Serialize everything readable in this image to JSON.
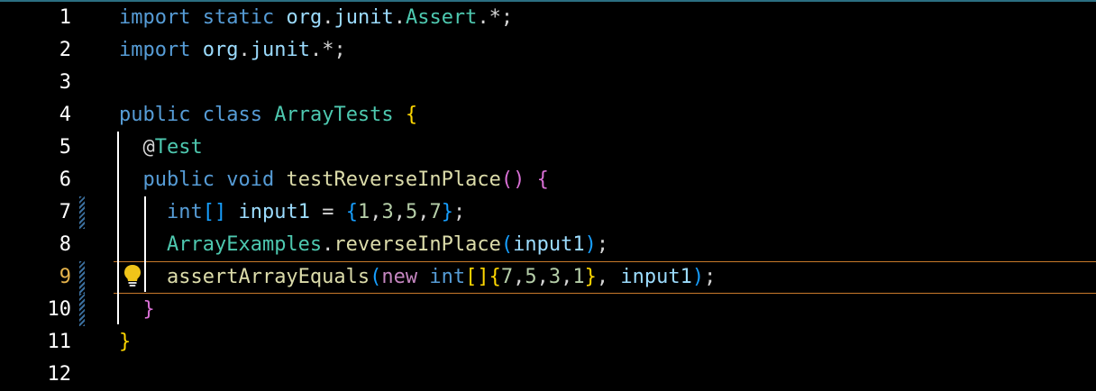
{
  "editor": {
    "active_line": 9,
    "lines": [
      {
        "n": "1",
        "tokens": [
          [
            "kw",
            "import"
          ],
          [
            "pl",
            " "
          ],
          [
            "kw",
            "static"
          ],
          [
            "pl",
            " "
          ],
          [
            "id",
            "org"
          ],
          [
            "pl",
            "."
          ],
          [
            "id",
            "junit"
          ],
          [
            "pl",
            "."
          ],
          [
            "ty",
            "Assert"
          ],
          [
            "pl",
            ".*;"
          ]
        ]
      },
      {
        "n": "2",
        "tokens": [
          [
            "kw",
            "import"
          ],
          [
            "pl",
            " "
          ],
          [
            "id",
            "org"
          ],
          [
            "pl",
            "."
          ],
          [
            "id",
            "junit"
          ],
          [
            "pl",
            ".*;"
          ]
        ]
      },
      {
        "n": "3",
        "tokens": []
      },
      {
        "n": "4",
        "tokens": [
          [
            "kw",
            "public"
          ],
          [
            "pl",
            " "
          ],
          [
            "kw",
            "class"
          ],
          [
            "pl",
            " "
          ],
          [
            "ty",
            "ArrayTests"
          ],
          [
            "pl",
            " "
          ],
          [
            "br1",
            "{"
          ]
        ]
      },
      {
        "n": "5",
        "tokens": [
          [
            "pl",
            "  "
          ],
          [
            "pl",
            "@"
          ],
          [
            "ty",
            "Test"
          ]
        ]
      },
      {
        "n": "6",
        "tokens": [
          [
            "pl",
            "  "
          ],
          [
            "kw",
            "public"
          ],
          [
            "pl",
            " "
          ],
          [
            "kw",
            "void"
          ],
          [
            "pl",
            " "
          ],
          [
            "fn",
            "testReverseInPlace"
          ],
          [
            "br2",
            "()"
          ],
          [
            "pl",
            " "
          ],
          [
            "br2",
            "{"
          ]
        ]
      },
      {
        "n": "7",
        "tokens": [
          [
            "pl",
            "    "
          ],
          [
            "kw",
            "int"
          ],
          [
            "br3",
            "[]"
          ],
          [
            "pl",
            " "
          ],
          [
            "id",
            "input1"
          ],
          [
            "pl",
            " = "
          ],
          [
            "br3",
            "{"
          ],
          [
            "num",
            "1"
          ],
          [
            "pl",
            ","
          ],
          [
            "num",
            "3"
          ],
          [
            "pl",
            ","
          ],
          [
            "num",
            "5"
          ],
          [
            "pl",
            ","
          ],
          [
            "num",
            "7"
          ],
          [
            "br3",
            "}"
          ],
          [
            "pl",
            ";"
          ]
        ]
      },
      {
        "n": "8",
        "tokens": [
          [
            "pl",
            "    "
          ],
          [
            "ty",
            "ArrayExamples"
          ],
          [
            "pl",
            "."
          ],
          [
            "fn",
            "reverseInPlace"
          ],
          [
            "br3",
            "("
          ],
          [
            "id",
            "input1"
          ],
          [
            "br3",
            ")"
          ],
          [
            "pl",
            ";"
          ]
        ]
      },
      {
        "n": "9",
        "tokens": [
          [
            "pl",
            "    "
          ],
          [
            "fn",
            "assertArrayEquals"
          ],
          [
            "br3",
            "("
          ],
          [
            "kw2",
            "new"
          ],
          [
            "pl",
            " "
          ],
          [
            "kw",
            "int"
          ],
          [
            "br1",
            "[]{"
          ],
          [
            "num",
            "7"
          ],
          [
            "pl",
            ","
          ],
          [
            "num",
            "5"
          ],
          [
            "pl",
            ","
          ],
          [
            "num",
            "3"
          ],
          [
            "pl",
            ","
          ],
          [
            "num",
            "1"
          ],
          [
            "br1",
            "}"
          ],
          [
            "pl",
            ", "
          ],
          [
            "id",
            "input1"
          ],
          [
            "br3",
            ")"
          ],
          [
            "pl",
            ";"
          ]
        ]
      },
      {
        "n": "10",
        "tokens": [
          [
            "pl",
            "  "
          ],
          [
            "br2",
            "}"
          ]
        ]
      },
      {
        "n": "11",
        "tokens": [
          [
            "br1",
            "}"
          ]
        ]
      },
      {
        "n": "12",
        "tokens": []
      }
    ],
    "modified_lines": [
      7,
      9,
      10
    ]
  },
  "icons": {
    "lightbulb": "lightbulb-icon"
  },
  "colors": {
    "keyword": "#569cd6",
    "type": "#4ec9b0",
    "function": "#dcdcaa",
    "current_line_border": "#c8792a",
    "active_line_number": "#e5b34b"
  }
}
